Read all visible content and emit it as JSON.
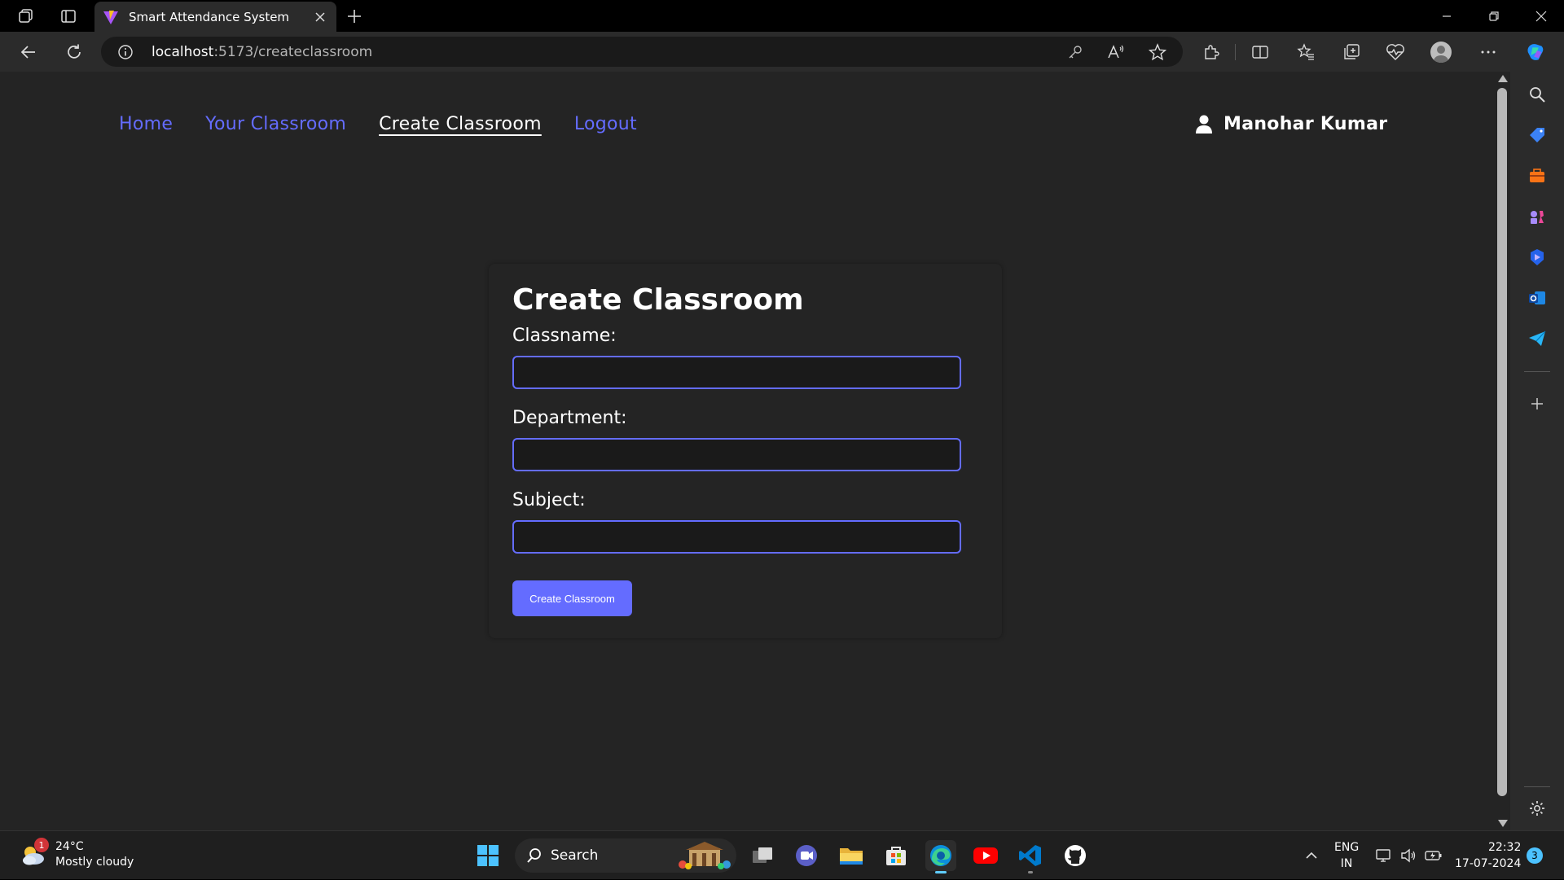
{
  "browser": {
    "tab_title": "Smart Attendance System",
    "url_host": "localhost",
    "url_path": ":5173/createclassroom"
  },
  "site": {
    "nav": {
      "home": "Home",
      "your_classroom": "Your Classroom",
      "create_classroom": "Create Classroom",
      "logout": "Logout"
    },
    "user_name": "Manohar Kumar",
    "accent_color": "#646cff"
  },
  "form": {
    "title": "Create Classroom",
    "classname_label": "Classname:",
    "classname_value": "",
    "department_label": "Department:",
    "department_value": "",
    "subject_label": "Subject:",
    "subject_value": "",
    "submit_label": "Create Classroom"
  },
  "taskbar": {
    "weather_badge": "1",
    "temperature": "24°C",
    "weather_desc": "Mostly cloudy",
    "search_label": "Search",
    "lang_line1": "ENG",
    "lang_line2": "IN",
    "time": "22:32",
    "date": "17-07-2024",
    "notification_count": "3"
  }
}
